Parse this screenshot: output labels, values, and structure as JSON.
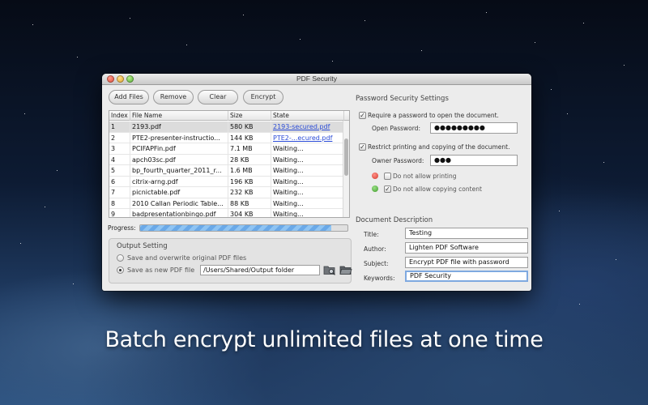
{
  "window": {
    "title": "PDF Security"
  },
  "toolbar": {
    "add_files": "Add Files",
    "remove": "Remove",
    "clear": "Clear",
    "encrypt": "Encrypt"
  },
  "table": {
    "headers": [
      "Index",
      "File Name",
      "Size",
      "State"
    ],
    "rows": [
      [
        "1",
        "2193.pdf",
        "580 KB",
        "2193-secured.pdf"
      ],
      [
        "2",
        "PTE2-presenter-instructio...",
        "144 KB",
        "PTE2-...ecured.pdf"
      ],
      [
        "3",
        "PCIFAPFin.pdf",
        "7.1 MB",
        "Waiting..."
      ],
      [
        "4",
        "apch03sc.pdf",
        "28 KB",
        "Waiting..."
      ],
      [
        "5",
        "bp_fourth_quarter_2011_r...",
        "1.6 MB",
        "Waiting..."
      ],
      [
        "6",
        "citrix-arng.pdf",
        "196 KB",
        "Waiting..."
      ],
      [
        "7",
        "picnictable.pdf",
        "232 KB",
        "Waiting..."
      ],
      [
        "8",
        "2010 Callan Periodic Table...",
        "88 KB",
        "Waiting..."
      ],
      [
        "9",
        "badpresentationbingo.pdf",
        "304 KB",
        "Waiting..."
      ]
    ]
  },
  "progress": {
    "label": "Progress:",
    "value": 0.92
  },
  "output": {
    "title": "Output Setting",
    "option_overwrite": "Save and overwrite original PDF files",
    "option_new": "Save as new PDF file",
    "path": "/Users/Shared/Output folder"
  },
  "password": {
    "title": "Password Security Settings",
    "require_open": "Require a password to open the document.",
    "open_label": "Open Password:",
    "open_value": "●●●●●●●●●",
    "restrict": "Restrict printing and copying of the document.",
    "owner_label": "Owner Password:",
    "owner_value": "●●●",
    "no_print": "Do not allow printing",
    "no_copy": "Do not allow copying content"
  },
  "description": {
    "title": "Document Description",
    "title_label": "Title:",
    "title_value": "Testing",
    "author_label": "Author:",
    "author_value": "Lighten PDF Software",
    "subject_label": "Subject:",
    "subject_value": "Encrypt PDF file with password",
    "keywords_label": "Keywords:",
    "keywords_value": "PDF Security"
  },
  "tagline": "Batch encrypt unlimited files at one time",
  "colors": {
    "link": "#2a4bd7",
    "progress": "#6aa9e8",
    "focus": "#7fa9e0"
  }
}
